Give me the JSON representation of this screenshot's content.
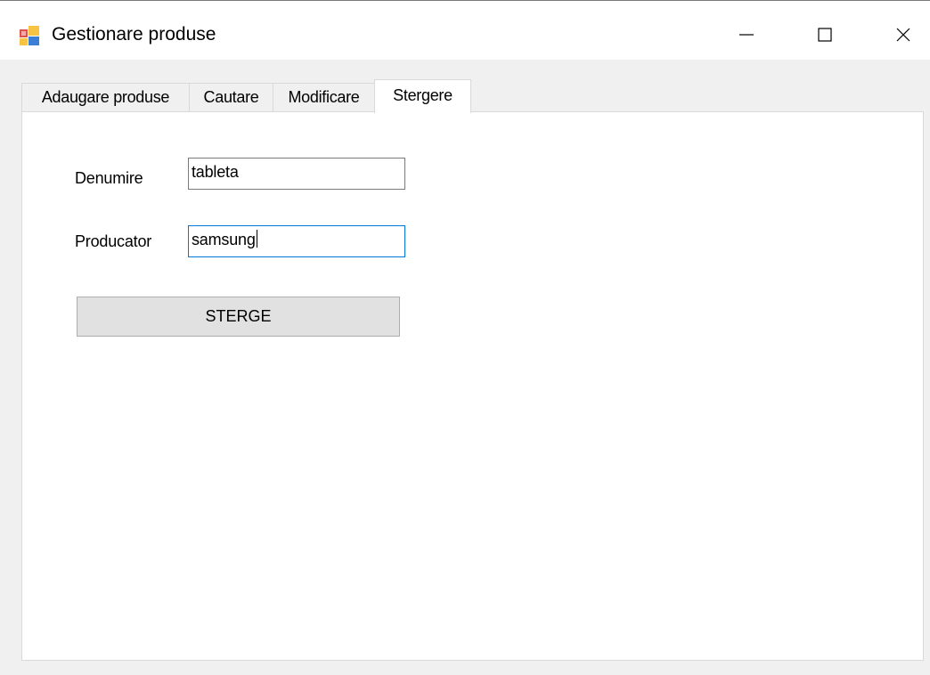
{
  "window": {
    "title": "Gestionare produse",
    "app_icon": "winforms-app-icon",
    "controls": {
      "minimize_icon": "minimize-icon",
      "maximize_icon": "maximize-icon",
      "close_icon": "close-icon"
    }
  },
  "tabs": [
    {
      "label": "Adaugare produse",
      "active": false
    },
    {
      "label": "Cautare",
      "active": false
    },
    {
      "label": "Modificare",
      "active": false
    },
    {
      "label": "Stergere",
      "active": true
    }
  ],
  "form": {
    "denumire": {
      "label": "Denumire",
      "value": "tableta"
    },
    "producator": {
      "label": "Producator",
      "value": "samsung",
      "focused": true
    },
    "delete_button": {
      "label": "STERGE"
    }
  },
  "colors": {
    "focus_border": "#0078d7",
    "button_bg": "#e1e1e1",
    "window_bg": "#f0f0f0"
  }
}
